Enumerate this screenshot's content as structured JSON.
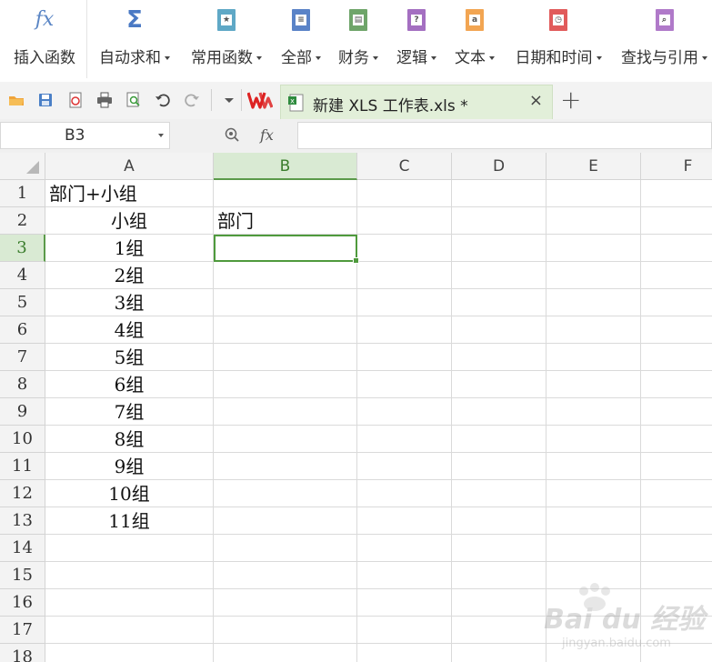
{
  "ribbon": {
    "insert_function": "插入函数",
    "items": [
      {
        "label": "自动求和",
        "icon": "sigma-icon",
        "color": "#4a79c4"
      },
      {
        "label": "常用函数",
        "icon": "star-book-icon",
        "color": "#5fa8c6"
      },
      {
        "label": "全部",
        "icon": "list-book-icon",
        "color": "#5a83c7"
      },
      {
        "label": "财务",
        "icon": "finance-book-icon",
        "color": "#6fa56a"
      },
      {
        "label": "逻辑",
        "icon": "logic-book-icon",
        "color": "#a46fc1"
      },
      {
        "label": "文本",
        "icon": "text-book-icon",
        "color": "#f2a552"
      },
      {
        "label": "日期和时间",
        "icon": "clock-book-icon",
        "color": "#e15b5b"
      },
      {
        "label": "查找与引用",
        "icon": "search-book-icon",
        "color": "#b07ac9"
      }
    ]
  },
  "tab": {
    "title": "新建 XLS 工作表.xls *",
    "close": "×",
    "new": "+"
  },
  "formula_bar": {
    "name_box": "B3",
    "fx": "fx",
    "content": ""
  },
  "sheet": {
    "columns": [
      "A",
      "B",
      "C",
      "D",
      "E",
      "F"
    ],
    "selected_column": "B",
    "selected_row": 3,
    "rows": [
      "1",
      "2",
      "3",
      "4",
      "5",
      "6",
      "7",
      "8",
      "9",
      "10",
      "11",
      "12",
      "13",
      "14",
      "15",
      "16",
      "17",
      "18"
    ],
    "cells": {
      "A1": "部门+小组",
      "A2": "小组",
      "B2": "部门",
      "A3": "1组",
      "A4": "2组",
      "A5": "3组",
      "A6": "4组",
      "A7": "5组",
      "A8": "6组",
      "A9": "7组",
      "A10": "8组",
      "A11": "9组",
      "A12": "10组",
      "A13": "11组"
    }
  },
  "watermark": {
    "brand": "Bai du 经验",
    "url": "jingyan.baidu.com"
  },
  "colors": {
    "selection": "#4f9a3d",
    "tab_active": "#e2efd9",
    "header_selected": "#d9ead3"
  }
}
